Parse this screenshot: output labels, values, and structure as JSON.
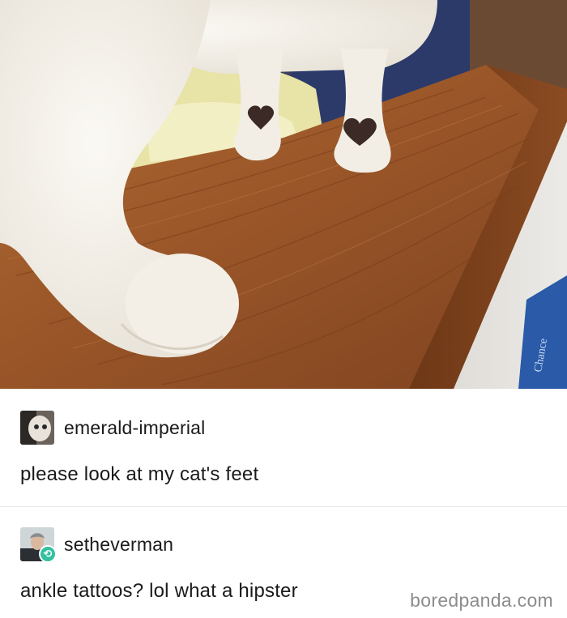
{
  "photo": {
    "subject": "cat-paws-photo",
    "box_label": "Chance"
  },
  "posts": [
    {
      "username": "emerald-imperial",
      "text": "please look at my cat's feet",
      "avatar_icon": "cat-avatar-icon"
    },
    {
      "username": "setheverman",
      "text": "ankle tattoos? lol what a hipster",
      "avatar_icon": "person-avatar-icon",
      "badge_icon": "reblog-icon"
    }
  ],
  "watermark": "boredpanda.com",
  "colors": {
    "wood": "#9b5a2a",
    "fur": "#f4f1ea",
    "heart_mark": "#3b2a26",
    "reblog_badge": "#33c0a0",
    "watermark": "#8c8c8c"
  }
}
